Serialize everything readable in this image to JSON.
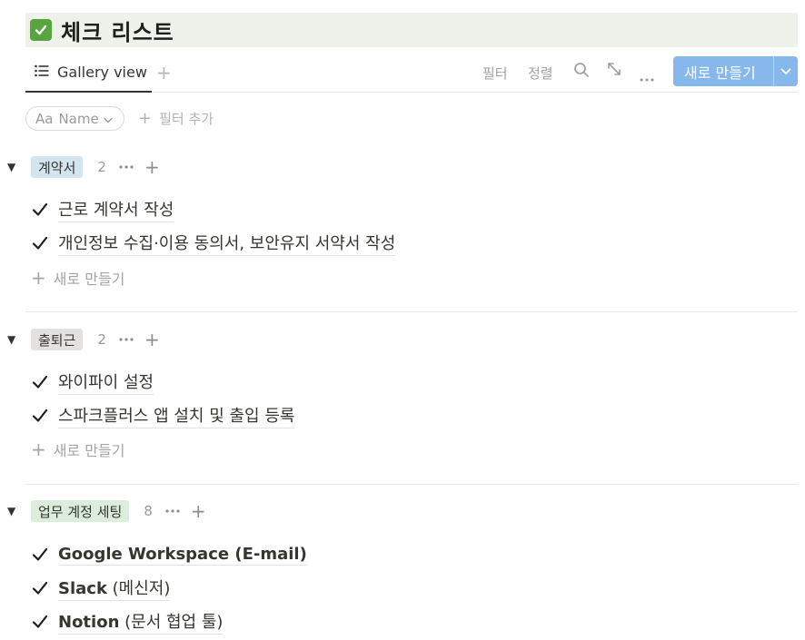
{
  "page": {
    "title": "체크 리스트",
    "title_icon": "check-mark-button-icon"
  },
  "view": {
    "tab_label": "Gallery view",
    "filter_label": "필터",
    "sort_label": "정렬",
    "new_button_label": "새로 만들기"
  },
  "filters": {
    "chip_prefix": "Aa",
    "chip_label": "Name",
    "add_filter_label": "필터 추가"
  },
  "colors": {
    "accent_blue": "#87b8ec",
    "title_check": "#58a53f",
    "tag_contract": "#d3e5ef",
    "tag_commute": "#e3e2e0",
    "tag_account": "#dbeddb"
  },
  "groups": [
    {
      "name": "계약서",
      "count": "2",
      "items": [
        {
          "title": "근로 계약서 작성"
        },
        {
          "title": "개인정보 수집·이용 동의서, 보안유지 서약서 작성"
        }
      ],
      "new_label": "새로 만들기"
    },
    {
      "name": "출퇴근",
      "count": "2",
      "items": [
        {
          "title": "와이파이 설정"
        },
        {
          "title": "스파크플러스 앱 설치 및 출입 등록"
        }
      ],
      "new_label": "새로 만들기"
    },
    {
      "name": "업무 계정 세팅",
      "count": "8",
      "items": [
        {
          "title_bold": "Google Workspace (E-mail)",
          "title_rest": ""
        },
        {
          "title_bold": "Slack",
          "title_rest": " (메신저)"
        },
        {
          "title_bold": "Notion",
          "title_rest": " (문서 협업 툴)"
        }
      ]
    }
  ]
}
